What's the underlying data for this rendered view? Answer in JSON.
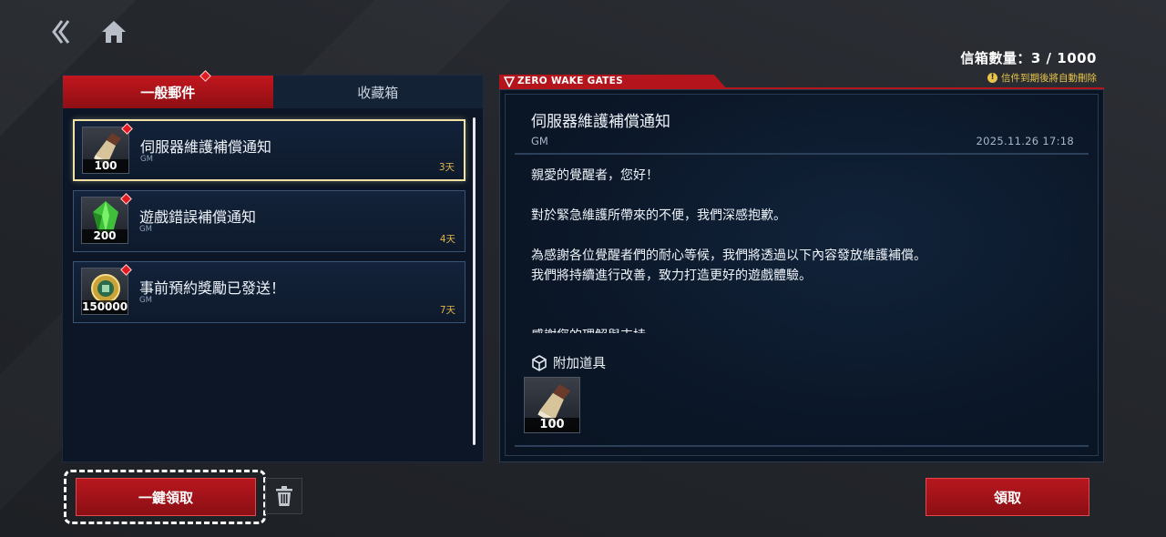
{
  "nav": {
    "back_icon": "double-chevron-left-icon",
    "home_icon": "home-icon"
  },
  "mailbox": {
    "count_label": "信箱數量：3 / 1000",
    "expire_note": "信件到期後將自動刪除"
  },
  "tabs": [
    {
      "label": "一般郵件",
      "active": true
    },
    {
      "label": "收藏箱",
      "active": false
    }
  ],
  "mail_list": [
    {
      "title": "伺服器維護補償通知",
      "sender": "GM",
      "days_left": "3天",
      "item_count": "100",
      "item_icon": "gauntlet-icon",
      "selected": true
    },
    {
      "title": "遊戲錯誤補償通知",
      "sender": "GM",
      "days_left": "4天",
      "item_count": "200",
      "item_icon": "green-crystal-icon",
      "selected": false
    },
    {
      "title": "事前預約獎勵已發送！",
      "sender": "GM",
      "days_left": "7天",
      "item_count": "150000",
      "item_icon": "gold-coin-icon",
      "selected": false
    }
  ],
  "detail": {
    "header_tag": "ZERO WAKE GATES",
    "title": "伺服器維護補償通知",
    "sender": "GM",
    "date": "2025.11.26 17:18",
    "body": [
      "親愛的覺醒者，您好！",
      "",
      "對於緊急維護所帶來的不便，我們深感抱歉。",
      "",
      "為感謝各位覺醒者們的耐心等候，我們將透過以下內容發放維護補償。",
      "我們將持續進行改善，致力打造更好的遊戲體驗。",
      "",
      "",
      "感謝您的理解與支持"
    ],
    "attachment_label": "附加道具",
    "attachment_count": "100"
  },
  "buttons": {
    "claim_all": "一鍵領取",
    "claim": "領取",
    "trash_icon": "trash-icon"
  },
  "colors": {
    "accent_red": "#b8171e",
    "highlight_gold": "#efe2a4",
    "days_gold": "#e3b74a"
  }
}
